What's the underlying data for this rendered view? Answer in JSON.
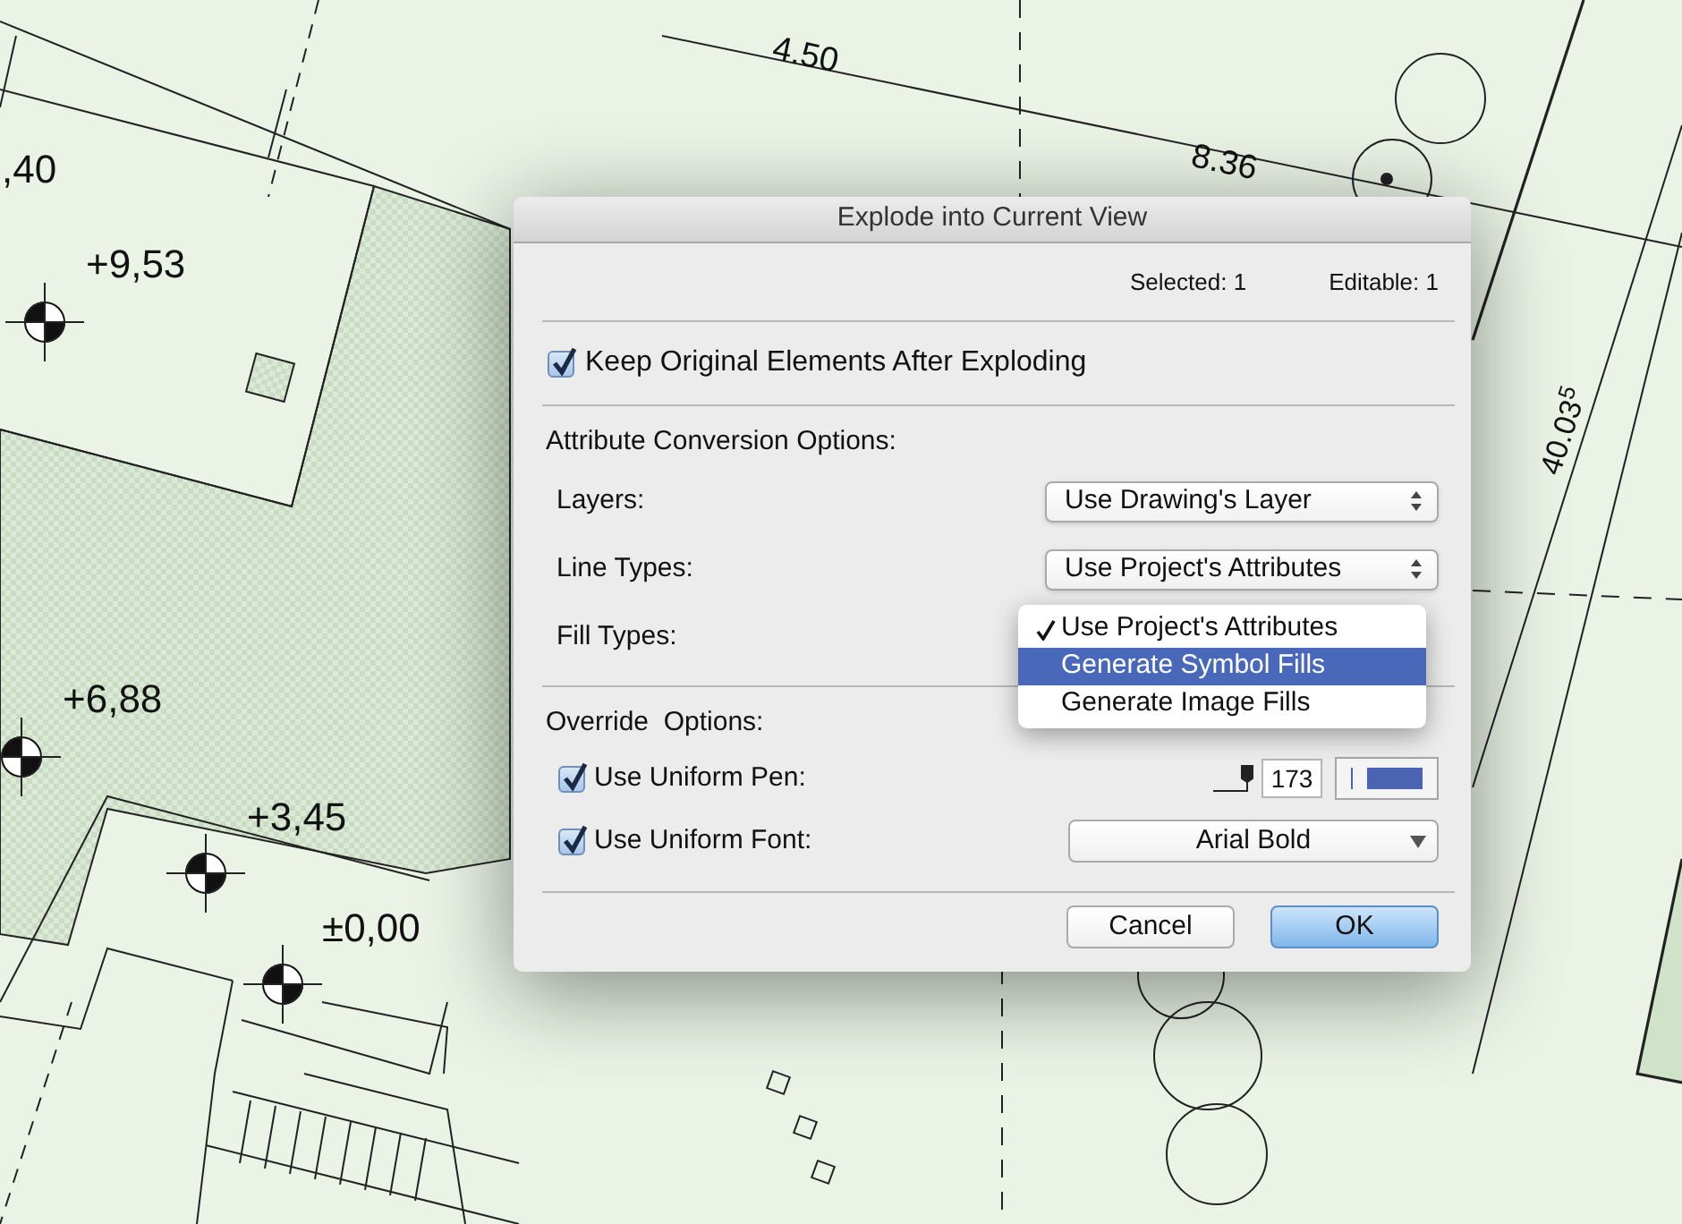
{
  "drawing": {
    "labels": [
      {
        "text": ",40"
      },
      {
        "text": "+9,53"
      },
      {
        "text": "+6,88"
      },
      {
        "text": "+3,45"
      },
      {
        "text": "±0,00"
      },
      {
        "text": "4.50"
      },
      {
        "text": "8.36"
      },
      {
        "text": "40.03$^{5}$"
      }
    ]
  },
  "dialog": {
    "title": "Explode into Current View",
    "counts": [
      "Selected: 1",
      "Editable: 1"
    ],
    "keep_original": {
      "label": "Keep Original Elements After Exploding",
      "checked": true
    },
    "attribute_section": {
      "title": "Attribute Conversion Options:",
      "rows": [
        {
          "kind": "popup",
          "label": "Layers:",
          "value": "Use Drawing's Layer"
        },
        {
          "kind": "popup",
          "label": "Line Types:",
          "value": "Use Project's Attributes"
        },
        {
          "kind": "menu",
          "label": "Fill Types:",
          "options": [
            {
              "label": "Use Project's Attributes",
              "checked": true,
              "selected": false
            },
            {
              "label": "Generate Symbol Fills",
              "checked": false,
              "selected": true
            },
            {
              "label": "Generate Image Fills",
              "checked": false,
              "selected": false
            }
          ]
        }
      ]
    },
    "override_section": {
      "title": "Override  Options:",
      "pen": {
        "label": "Use Uniform Pen:",
        "checked": true,
        "value": "173"
      },
      "font": {
        "label": "Use Uniform Font:",
        "checked": true,
        "value": "Arial Bold"
      }
    },
    "buttons": [
      {
        "label": "Cancel",
        "kind": "secondary"
      },
      {
        "label": "OK",
        "kind": "default"
      }
    ]
  }
}
